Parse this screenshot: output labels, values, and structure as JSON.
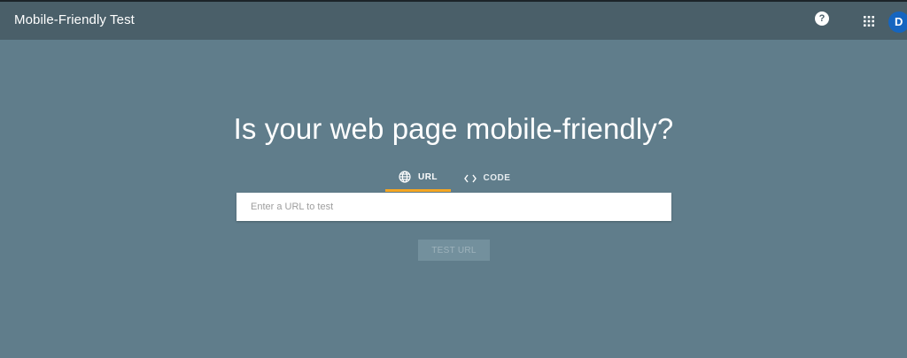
{
  "app_bar": {
    "title": "Mobile-Friendly Test",
    "help_icon_label": "?",
    "apps_icon": "apps-grid-icon",
    "avatar_initial": "D"
  },
  "main": {
    "title": "Is your web page mobile-friendly?",
    "tabs": [
      {
        "label": "URL",
        "icon": "globe-icon",
        "selected": true
      },
      {
        "label": "CODE",
        "icon": "code-brackets-icon",
        "selected": false
      }
    ],
    "url_input": {
      "placeholder": "Enter a URL to test",
      "value": ""
    },
    "test_button": {
      "label": "TEST URL",
      "enabled": false
    }
  },
  "colors": {
    "page_background": "#607d8b",
    "app_bar_background": "#4a5f69",
    "tab_indicator": "#f5a623",
    "avatar_background": "#1565c0"
  }
}
